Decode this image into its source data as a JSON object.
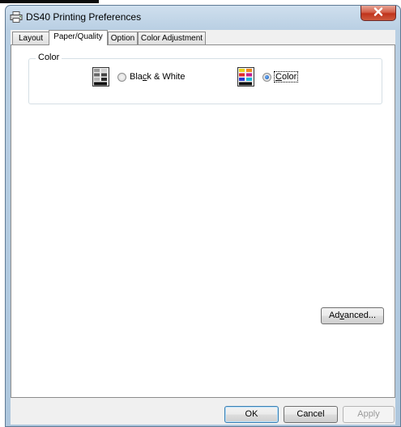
{
  "window": {
    "title": "DS40 Printing Preferences"
  },
  "tabs": [
    {
      "label": "Layout"
    },
    {
      "label": "Paper/Quality"
    },
    {
      "label": "Option"
    },
    {
      "label": "Color Adjustment"
    }
  ],
  "active_tab": "Paper/Quality",
  "color_group": {
    "title": "Color",
    "options": [
      {
        "label_pre": "Bla",
        "label_acc": "c",
        "label_post": "k & White",
        "selected": false
      },
      {
        "label_pre": "",
        "label_acc": "C",
        "label_post": "olor",
        "selected": true
      }
    ]
  },
  "advanced": {
    "label_pre": "Ad",
    "label_acc": "v",
    "label_post": "anced..."
  },
  "footer": {
    "ok": "OK",
    "cancel": "Cancel",
    "apply": "Apply"
  },
  "icons": {
    "app": "printer-icon",
    "close": "close-icon",
    "bw": "printer-bw-icon",
    "color": "printer-color-icon"
  },
  "colors": {
    "close_button": "#c0331c",
    "panel_bg": "#ffffff",
    "dialog_bg": "#f0f0f0",
    "frame": "#aec7de"
  }
}
